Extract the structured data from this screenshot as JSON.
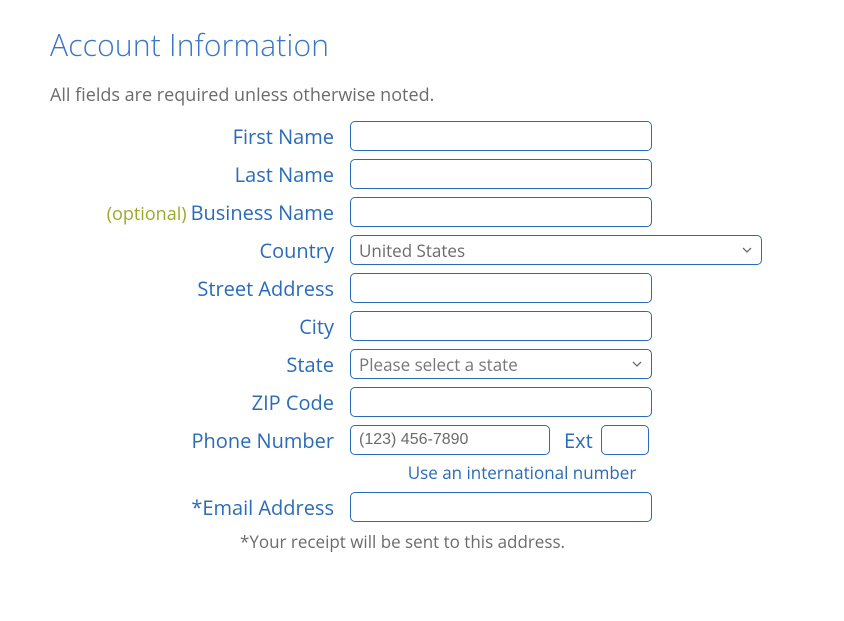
{
  "header": {
    "title": "Account Information",
    "subtitle": "All fields are required unless otherwise noted."
  },
  "labels": {
    "first_name": "First Name",
    "last_name": "Last Name",
    "business_optional": "(optional)",
    "business_name": "Business Name",
    "country": "Country",
    "street": "Street Address",
    "city": "City",
    "state": "State",
    "zip": "ZIP Code",
    "phone": "Phone Number",
    "ext": "Ext",
    "email": "*Email Address"
  },
  "fields": {
    "first_name": "",
    "last_name": "",
    "business_name": "",
    "country_selected": "United States",
    "street": "",
    "city": "",
    "state_selected": "Please select a state",
    "zip": "",
    "phone_placeholder": "(123) 456-7890",
    "phone": "",
    "ext": "",
    "email": ""
  },
  "hints": {
    "intl_link": "Use an international number",
    "email_footnote": "*Your receipt will be sent to this address."
  }
}
